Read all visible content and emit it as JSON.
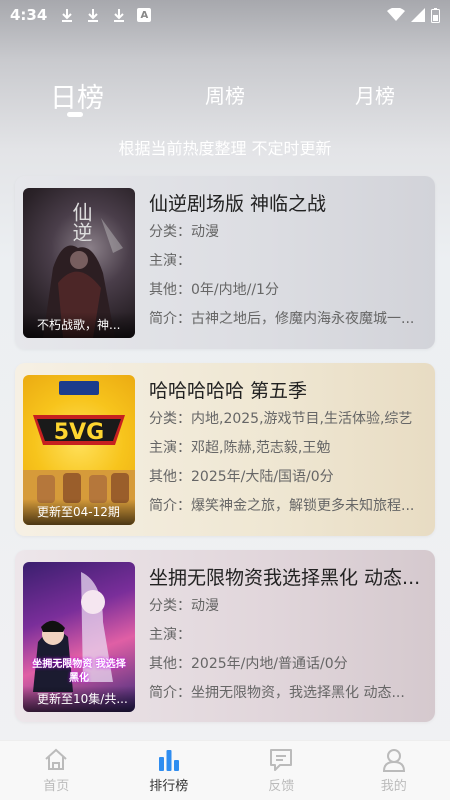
{
  "status_bar": {
    "time": "4:34",
    "left_icons": [
      "download-icon",
      "download-icon",
      "download-icon",
      "a-icon"
    ],
    "right_icons": [
      "wifi-icon",
      "signal-icon",
      "battery-icon"
    ]
  },
  "tabs": [
    {
      "label": "日榜",
      "active": true
    },
    {
      "label": "周榜",
      "active": false
    },
    {
      "label": "月榜",
      "active": false
    }
  ],
  "subtitle": "根据当前热度整理 不定时更新",
  "cards": [
    {
      "title": "仙逆剧场版 神临之战",
      "category": "分类：动漫",
      "cast": "主演：",
      "other": "其他：0年/内地//1分",
      "intro": "简介：古神之地后，修魔内海永夜魔城一...",
      "poster_caption": "不朽战歌，神...",
      "poster_text": "仙逆"
    },
    {
      "title": "哈哈哈哈哈 第五季",
      "category": "分类：内地,2025,游戏节目,生活体验,综艺",
      "cast": "主演：邓超,陈赫,范志毅,王勉",
      "other": "其他：2025年/大陆/国语/0分",
      "intro": "简介：爆笑神金之旅，解锁更多未知旅程...",
      "poster_caption": "更新至04-12期",
      "poster_text": "5VG"
    },
    {
      "title": "坐拥无限物资我选择黑化 动态...",
      "category": "分类：动漫",
      "cast": "主演：",
      "other": "其他：2025年/内地/普通话/0分",
      "intro": "简介：坐拥无限物资，我选择黑化 动态...",
      "poster_caption": "更新至10集/共...",
      "poster_text": "坐拥无限物资 我选择黑化"
    }
  ],
  "nav": [
    {
      "label": "首页",
      "icon": "home-icon",
      "active": false
    },
    {
      "label": "排行榜",
      "icon": "chart-icon",
      "active": true
    },
    {
      "label": "反馈",
      "icon": "feedback-icon",
      "active": false
    },
    {
      "label": "我的",
      "icon": "user-icon",
      "active": false
    }
  ],
  "colors": {
    "accent": "#2f8df0",
    "inactive": "#bbbbbb"
  }
}
